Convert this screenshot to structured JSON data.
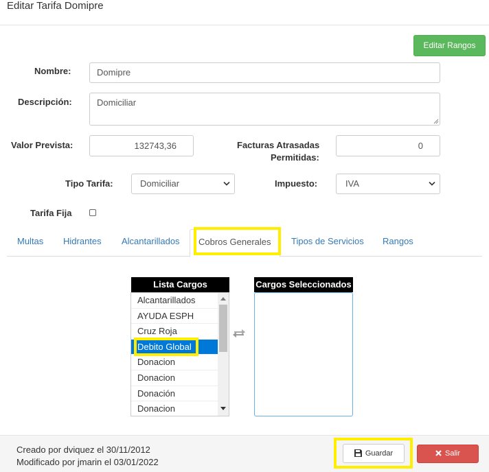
{
  "modal": {
    "title": "Editar Tarifa Domipre"
  },
  "toolbar": {
    "rangos_label": "Editar Rangos"
  },
  "form": {
    "nombre_label": "Nombre:",
    "nombre_value": "Domipre",
    "descripcion_label": "Descripción:",
    "descripcion_value": "Domiciliar",
    "valor_label": "Valor Prevista:",
    "valor_value": "132743,36",
    "facturas_label_1": "Facturas Atrasadas",
    "facturas_label_2": "Permitidas:",
    "facturas_value": "0",
    "tipo_label": "Tipo Tarifa:",
    "tipo_value": "Domiciliar",
    "impuesto_label": "Impuesto:",
    "impuesto_value": "IVA",
    "fija_label": "Tarifa Fija",
    "fija_checked": false
  },
  "tabs": [
    {
      "label": "Multas"
    },
    {
      "label": "Hidrantes"
    },
    {
      "label": "Alcantarillados"
    },
    {
      "label": "Cobros Generales",
      "active": true
    },
    {
      "label": "Tipos de Servicios"
    },
    {
      "label": "Rangos"
    }
  ],
  "lista": {
    "header": "Lista Cargos",
    "items": [
      "Alcantarillados",
      "AYUDA ESPH",
      "Cruz Roja",
      "Debito Global",
      "Donacion",
      "Donacion",
      "Donación",
      "Donacion"
    ],
    "selected": "Debito Global"
  },
  "seleccionados": {
    "header": "Cargos Seleccionados",
    "items": []
  },
  "footer": {
    "created": "Creado por dviquez el 30/11/2012",
    "modified": "Modificado por jmarin el 03/01/2022",
    "guardar_label": "Guardar",
    "salir_label": "Salir"
  },
  "colors": {
    "success": "#5cb85c",
    "danger": "#d9534f",
    "primary": "#337ab7",
    "selection": "#0078d7",
    "highlight": "#ffee00"
  },
  "icons": {
    "transfer": "exchange-icon",
    "save": "floppy-icon",
    "close": "times-icon",
    "dropdown": "chevron-down-icon"
  }
}
